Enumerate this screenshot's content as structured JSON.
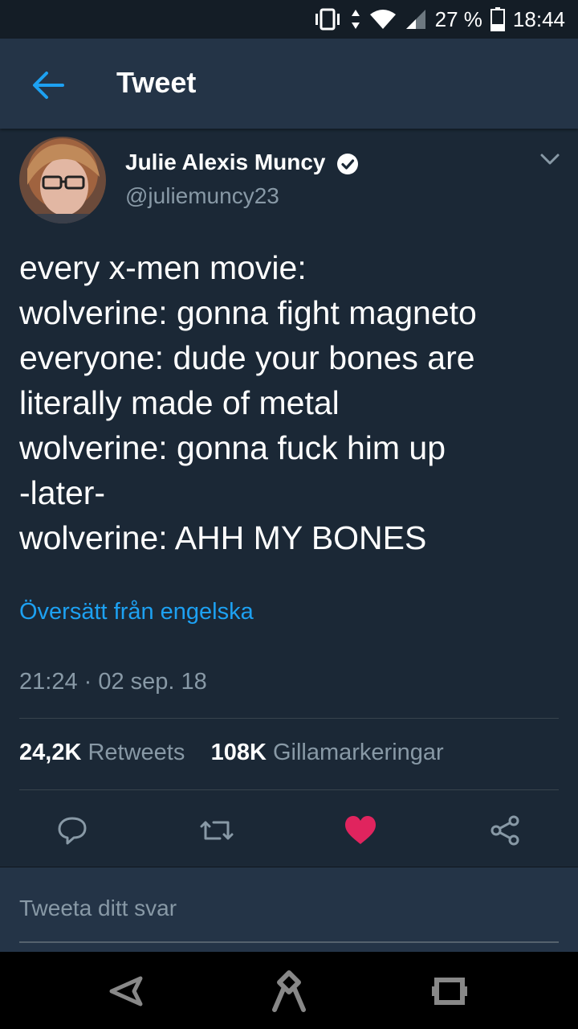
{
  "status_bar": {
    "battery_percent": "27 %",
    "time": "18:44",
    "icons": [
      "vibrate-icon",
      "data-arrows-icon",
      "wifi-icon",
      "signal-icon",
      "battery-icon"
    ]
  },
  "app_bar": {
    "title": "Tweet",
    "back_icon": "arrow-left-icon"
  },
  "tweet": {
    "author_name": "Julie Alexis Muncy",
    "handle": "@juliemuncy23",
    "verified": true,
    "lines": [
      "every x-men movie:",
      "wolverine: gonna fight magneto",
      "everyone: dude your bones are",
      "literally made of metal",
      "wolverine: gonna fuck him up",
      "-later-",
      "wolverine: AHH MY BONES"
    ],
    "translate_label": "Översätt från engelska",
    "timestamp": "21:24 · 02 sep. 18",
    "retweets_count": "24,2K",
    "retweets_label": "Retweets",
    "likes_count": "108K",
    "likes_label": "Gillamarkeringar"
  },
  "actions": {
    "icons": [
      "reply-icon",
      "retweet-icon",
      "heart-icon",
      "share-icon"
    ],
    "liked": true
  },
  "reply": {
    "placeholder": "Tweeta ditt svar"
  },
  "nav_bar": {
    "icons": [
      "back-nav-icon",
      "home-nav-icon",
      "recents-nav-icon"
    ]
  },
  "colors": {
    "background": "#1b2836",
    "app_bar": "#243447",
    "accent": "#1da1f2",
    "secondary_text": "#8899a6",
    "like": "#e0245e"
  }
}
